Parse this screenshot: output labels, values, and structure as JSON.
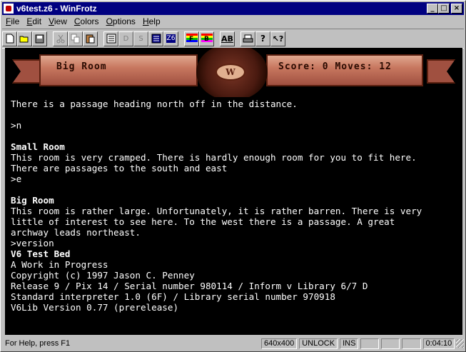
{
  "window": {
    "title": "v6test.z6 - WinFrotz"
  },
  "menu": [
    {
      "label": "File",
      "accel": "F",
      "rest": "ile"
    },
    {
      "label": "Edit",
      "accel": "E",
      "rest": "dit"
    },
    {
      "label": "View",
      "accel": "V",
      "rest": "iew"
    },
    {
      "label": "Colors",
      "accel": "C",
      "rest": "olors"
    },
    {
      "label": "Options",
      "accel": "O",
      "rest": "ptions"
    },
    {
      "label": "Help",
      "accel": "H",
      "rest": "elp"
    }
  ],
  "banner": {
    "location": "Big Room",
    "score_moves": "Score: 0 Moves: 12"
  },
  "transcript": [
    {
      "text": "There is a passage heading north off in the distance.",
      "bold": false
    },
    {
      "text": "",
      "bold": false
    },
    {
      "text": ">n",
      "bold": false
    },
    {
      "text": "",
      "bold": false
    },
    {
      "text": "Small Room",
      "bold": true
    },
    {
      "text": "This room is very cramped. There is hardly enough room for you to fit here.",
      "bold": false
    },
    {
      "text": "There are passages to the south and east",
      "bold": false
    },
    {
      "text": ">e",
      "bold": false
    },
    {
      "text": "",
      "bold": false
    },
    {
      "text": "Big Room",
      "bold": true
    },
    {
      "text": "This room is rather large. Unfortunately, it is rather barren. There is very",
      "bold": false
    },
    {
      "text": "little of interest to see here. To the west there is a passage. A great",
      "bold": false
    },
    {
      "text": "archway leads northeast.",
      "bold": false
    },
    {
      "text": ">version",
      "bold": false
    },
    {
      "text": "V6 Test Bed",
      "bold": true
    },
    {
      "text": "A Work in Progress",
      "bold": false
    },
    {
      "text": "Copyright (c) 1997 Jason C. Penney",
      "bold": false
    },
    {
      "text": "Release 9 / Pix 14 / Serial number 980114 / Inform v Library 6/7 D",
      "bold": false
    },
    {
      "text": "Standard interpreter 1.0 (6F) / Library serial number 970918",
      "bold": false
    },
    {
      "text": "V6Lib Version 0.77 (prerelease)",
      "bold": false
    },
    {
      "text": "",
      "bold": false
    },
    {
      "text": "",
      "bold": false
    },
    {
      "text": ">",
      "bold": false
    }
  ],
  "status": {
    "help": "For Help, press F1",
    "resolution": "640x400",
    "unlock": "UNLOCK",
    "ins": "INS",
    "time": "0:04:10"
  },
  "colors": {
    "titlebar": "#000080",
    "game_bg": "#000000",
    "game_fg": "#ffffff",
    "ribbon": "#c87860"
  }
}
